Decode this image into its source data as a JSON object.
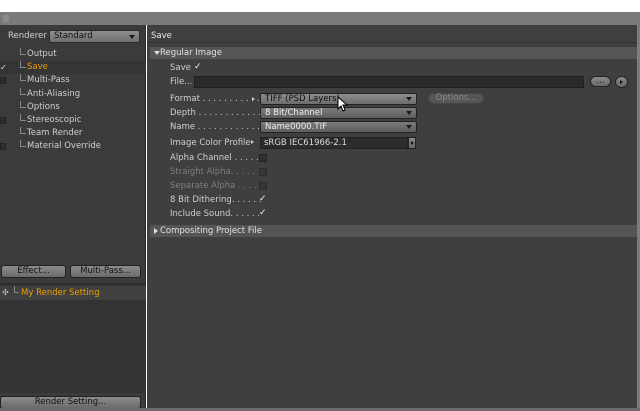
{
  "left_panel": {
    "renderer_label": "Renderer",
    "renderer_value": "Standard",
    "tree": [
      {
        "label": "Output",
        "checked": false,
        "has_checkbox": false,
        "active": false
      },
      {
        "label": "Save",
        "checked": true,
        "has_checkbox": true,
        "active": true
      },
      {
        "label": "Multi-Pass",
        "checked": false,
        "has_checkbox": true,
        "active": false
      },
      {
        "label": "Anti-Aliasing",
        "checked": false,
        "has_checkbox": false,
        "active": false
      },
      {
        "label": "Options",
        "checked": false,
        "has_checkbox": false,
        "active": false
      },
      {
        "label": "Stereoscopic",
        "checked": false,
        "has_checkbox": true,
        "active": false
      },
      {
        "label": "Team Render",
        "checked": false,
        "has_checkbox": false,
        "active": false
      },
      {
        "label": "Material Override",
        "checked": false,
        "has_checkbox": true,
        "active": false
      }
    ],
    "effect_button": "Effect...",
    "multipass_button": "Multi-Pass...",
    "render_setting_item": "My Render Setting",
    "render_setting_button": "Render Setting..."
  },
  "right_panel": {
    "header": "Save",
    "regular_image": {
      "title": "Regular Image",
      "save_label": "Save",
      "save_checked": true,
      "file_label": "File...",
      "file_value": "",
      "file_dots_button": "...",
      "format_label": "Format . . . . . . . . . . . .",
      "format_value": "TIFF (PSD Layers)",
      "options_button": "Options...",
      "depth_label": "Depth . . . . . . . . . . . .",
      "depth_value": "8 Bit/Channel",
      "name_label": "Name . . . . . . . . . . . . .",
      "name_value": "Name0000.TIF",
      "profile_label": "Image Color Profile",
      "profile_value": "sRGB IEC61966-2.1",
      "alpha_label": "Alpha Channel . . . . .",
      "alpha_checked": false,
      "straight_label": "Straight Alpha. . . . . .",
      "straight_checked": false,
      "separate_label": "Separate Alpha . . . . .",
      "separate_checked": false,
      "dithering_label": "8 Bit Dithering. . . . . .",
      "dithering_checked": true,
      "sound_label": "Include Sound. . . . . .",
      "sound_checked": true
    },
    "compositing_title": "Compositing Project File"
  },
  "colors": {
    "accent": "#f0a000",
    "panel_bg": "#3f3f3f",
    "left_bg": "#3b3b3b"
  }
}
